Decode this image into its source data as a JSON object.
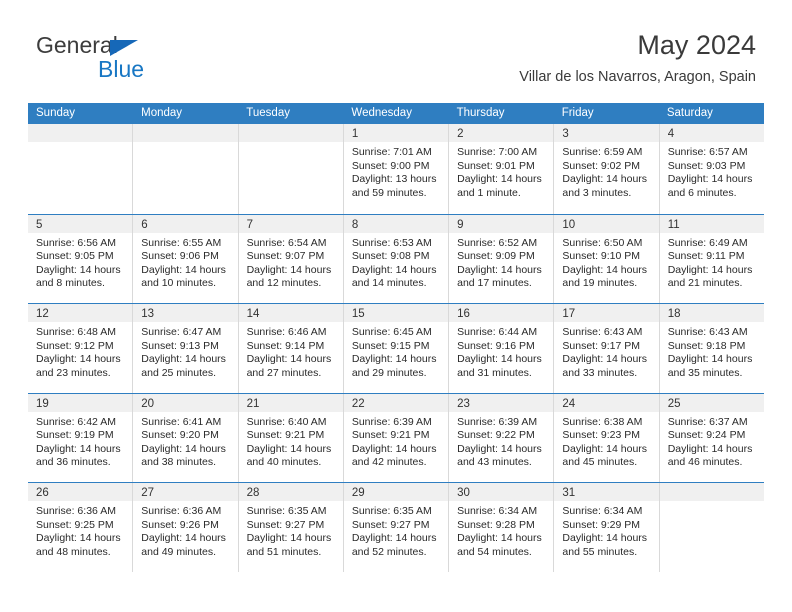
{
  "brand": {
    "name_part1": "General",
    "name_part2": "Blue",
    "triangle_icon": "triangle-icon",
    "accent_color": "#1877c4"
  },
  "header": {
    "title": "May 2024",
    "subtitle": "Villar de los Navarros, Aragon, Spain"
  },
  "theme": {
    "header_blue": "#2f7ec1",
    "day_band_gray": "#f0f0f0",
    "grid_line": "#d9d9d9"
  },
  "calendar": {
    "weekdays": [
      "Sunday",
      "Monday",
      "Tuesday",
      "Wednesday",
      "Thursday",
      "Friday",
      "Saturday"
    ],
    "weeks": [
      [
        {
          "day": "",
          "empty": true
        },
        {
          "day": "",
          "empty": true
        },
        {
          "day": "",
          "empty": true
        },
        {
          "day": "1",
          "sunrise": "Sunrise: 7:01 AM",
          "sunset": "Sunset: 9:00 PM",
          "daylight": "Daylight: 13 hours and 59 minutes."
        },
        {
          "day": "2",
          "sunrise": "Sunrise: 7:00 AM",
          "sunset": "Sunset: 9:01 PM",
          "daylight": "Daylight: 14 hours and 1 minute."
        },
        {
          "day": "3",
          "sunrise": "Sunrise: 6:59 AM",
          "sunset": "Sunset: 9:02 PM",
          "daylight": "Daylight: 14 hours and 3 minutes."
        },
        {
          "day": "4",
          "sunrise": "Sunrise: 6:57 AM",
          "sunset": "Sunset: 9:03 PM",
          "daylight": "Daylight: 14 hours and 6 minutes."
        }
      ],
      [
        {
          "day": "5",
          "sunrise": "Sunrise: 6:56 AM",
          "sunset": "Sunset: 9:05 PM",
          "daylight": "Daylight: 14 hours and 8 minutes."
        },
        {
          "day": "6",
          "sunrise": "Sunrise: 6:55 AM",
          "sunset": "Sunset: 9:06 PM",
          "daylight": "Daylight: 14 hours and 10 minutes."
        },
        {
          "day": "7",
          "sunrise": "Sunrise: 6:54 AM",
          "sunset": "Sunset: 9:07 PM",
          "daylight": "Daylight: 14 hours and 12 minutes."
        },
        {
          "day": "8",
          "sunrise": "Sunrise: 6:53 AM",
          "sunset": "Sunset: 9:08 PM",
          "daylight": "Daylight: 14 hours and 14 minutes."
        },
        {
          "day": "9",
          "sunrise": "Sunrise: 6:52 AM",
          "sunset": "Sunset: 9:09 PM",
          "daylight": "Daylight: 14 hours and 17 minutes."
        },
        {
          "day": "10",
          "sunrise": "Sunrise: 6:50 AM",
          "sunset": "Sunset: 9:10 PM",
          "daylight": "Daylight: 14 hours and 19 minutes."
        },
        {
          "day": "11",
          "sunrise": "Sunrise: 6:49 AM",
          "sunset": "Sunset: 9:11 PM",
          "daylight": "Daylight: 14 hours and 21 minutes."
        }
      ],
      [
        {
          "day": "12",
          "sunrise": "Sunrise: 6:48 AM",
          "sunset": "Sunset: 9:12 PM",
          "daylight": "Daylight: 14 hours and 23 minutes."
        },
        {
          "day": "13",
          "sunrise": "Sunrise: 6:47 AM",
          "sunset": "Sunset: 9:13 PM",
          "daylight": "Daylight: 14 hours and 25 minutes."
        },
        {
          "day": "14",
          "sunrise": "Sunrise: 6:46 AM",
          "sunset": "Sunset: 9:14 PM",
          "daylight": "Daylight: 14 hours and 27 minutes."
        },
        {
          "day": "15",
          "sunrise": "Sunrise: 6:45 AM",
          "sunset": "Sunset: 9:15 PM",
          "daylight": "Daylight: 14 hours and 29 minutes."
        },
        {
          "day": "16",
          "sunrise": "Sunrise: 6:44 AM",
          "sunset": "Sunset: 9:16 PM",
          "daylight": "Daylight: 14 hours and 31 minutes."
        },
        {
          "day": "17",
          "sunrise": "Sunrise: 6:43 AM",
          "sunset": "Sunset: 9:17 PM",
          "daylight": "Daylight: 14 hours and 33 minutes."
        },
        {
          "day": "18",
          "sunrise": "Sunrise: 6:43 AM",
          "sunset": "Sunset: 9:18 PM",
          "daylight": "Daylight: 14 hours and 35 minutes."
        }
      ],
      [
        {
          "day": "19",
          "sunrise": "Sunrise: 6:42 AM",
          "sunset": "Sunset: 9:19 PM",
          "daylight": "Daylight: 14 hours and 36 minutes."
        },
        {
          "day": "20",
          "sunrise": "Sunrise: 6:41 AM",
          "sunset": "Sunset: 9:20 PM",
          "daylight": "Daylight: 14 hours and 38 minutes."
        },
        {
          "day": "21",
          "sunrise": "Sunrise: 6:40 AM",
          "sunset": "Sunset: 9:21 PM",
          "daylight": "Daylight: 14 hours and 40 minutes."
        },
        {
          "day": "22",
          "sunrise": "Sunrise: 6:39 AM",
          "sunset": "Sunset: 9:21 PM",
          "daylight": "Daylight: 14 hours and 42 minutes."
        },
        {
          "day": "23",
          "sunrise": "Sunrise: 6:39 AM",
          "sunset": "Sunset: 9:22 PM",
          "daylight": "Daylight: 14 hours and 43 minutes."
        },
        {
          "day": "24",
          "sunrise": "Sunrise: 6:38 AM",
          "sunset": "Sunset: 9:23 PM",
          "daylight": "Daylight: 14 hours and 45 minutes."
        },
        {
          "day": "25",
          "sunrise": "Sunrise: 6:37 AM",
          "sunset": "Sunset: 9:24 PM",
          "daylight": "Daylight: 14 hours and 46 minutes."
        }
      ],
      [
        {
          "day": "26",
          "sunrise": "Sunrise: 6:36 AM",
          "sunset": "Sunset: 9:25 PM",
          "daylight": "Daylight: 14 hours and 48 minutes."
        },
        {
          "day": "27",
          "sunrise": "Sunrise: 6:36 AM",
          "sunset": "Sunset: 9:26 PM",
          "daylight": "Daylight: 14 hours and 49 minutes."
        },
        {
          "day": "28",
          "sunrise": "Sunrise: 6:35 AM",
          "sunset": "Sunset: 9:27 PM",
          "daylight": "Daylight: 14 hours and 51 minutes."
        },
        {
          "day": "29",
          "sunrise": "Sunrise: 6:35 AM",
          "sunset": "Sunset: 9:27 PM",
          "daylight": "Daylight: 14 hours and 52 minutes."
        },
        {
          "day": "30",
          "sunrise": "Sunrise: 6:34 AM",
          "sunset": "Sunset: 9:28 PM",
          "daylight": "Daylight: 14 hours and 54 minutes."
        },
        {
          "day": "31",
          "sunrise": "Sunrise: 6:34 AM",
          "sunset": "Sunset: 9:29 PM",
          "daylight": "Daylight: 14 hours and 55 minutes."
        },
        {
          "day": "",
          "empty": true
        }
      ]
    ]
  }
}
